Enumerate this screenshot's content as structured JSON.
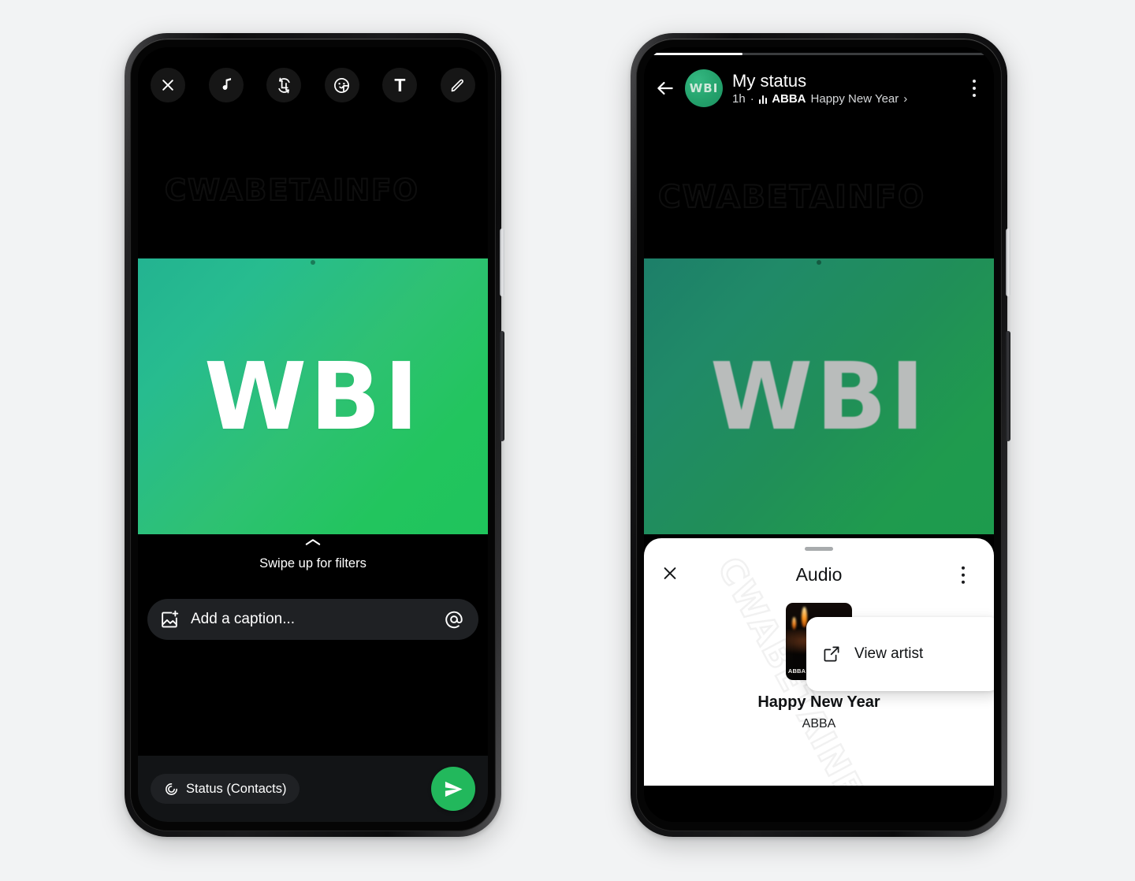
{
  "watermark": "CWABETAINFO",
  "colors": {
    "background": "#f2f3f4",
    "accent_green": "#22b85c",
    "avatar_green": "#24a26c",
    "media_gradient_from": "#23b391",
    "media_gradient_to": "#22c55e",
    "sheet_white": "#ffffff",
    "toolbar_icon": "#ffffff"
  },
  "left_phone": {
    "toolbar": {
      "close_label": "✕",
      "items": [
        {
          "name": "close-button",
          "icon": "close-icon"
        },
        {
          "name": "music-button",
          "icon": "music-note-icon"
        },
        {
          "name": "crop-rotate-button",
          "icon": "crop-rotate-icon"
        },
        {
          "name": "sticker-button",
          "icon": "sticker-icon"
        },
        {
          "name": "text-button",
          "icon": "text-icon",
          "label": "T"
        },
        {
          "name": "draw-button",
          "icon": "pencil-icon"
        }
      ]
    },
    "media": {
      "logo_text": "WBI"
    },
    "filters": {
      "hint": "Swipe up for filters"
    },
    "caption": {
      "placeholder": "Add a caption...",
      "mention_icon": "at-icon"
    },
    "bottom": {
      "audience_label": "Status (Contacts)",
      "send_icon": "send-icon"
    }
  },
  "right_phone": {
    "progress": {
      "percent": 27
    },
    "header": {
      "back_icon": "back-arrow-icon",
      "avatar_text": "WBI",
      "title": "My status",
      "time": "1h",
      "separator": "·",
      "audio_icon": "equalizer-icon",
      "artist": "ABBA",
      "track": "Happy New Year",
      "chevron": "›",
      "menu_icon": "kebab-menu-icon"
    },
    "media": {
      "logo_text": "WBI"
    },
    "sheet": {
      "title": "Audio",
      "close_icon": "close-icon",
      "menu_icon": "kebab-menu-icon",
      "album_caption": "ABBA Super Trouper",
      "track_title": "Happy New Year",
      "track_artist": "ABBA"
    },
    "popup": {
      "label": "View artist",
      "icon": "external-link-icon"
    }
  }
}
